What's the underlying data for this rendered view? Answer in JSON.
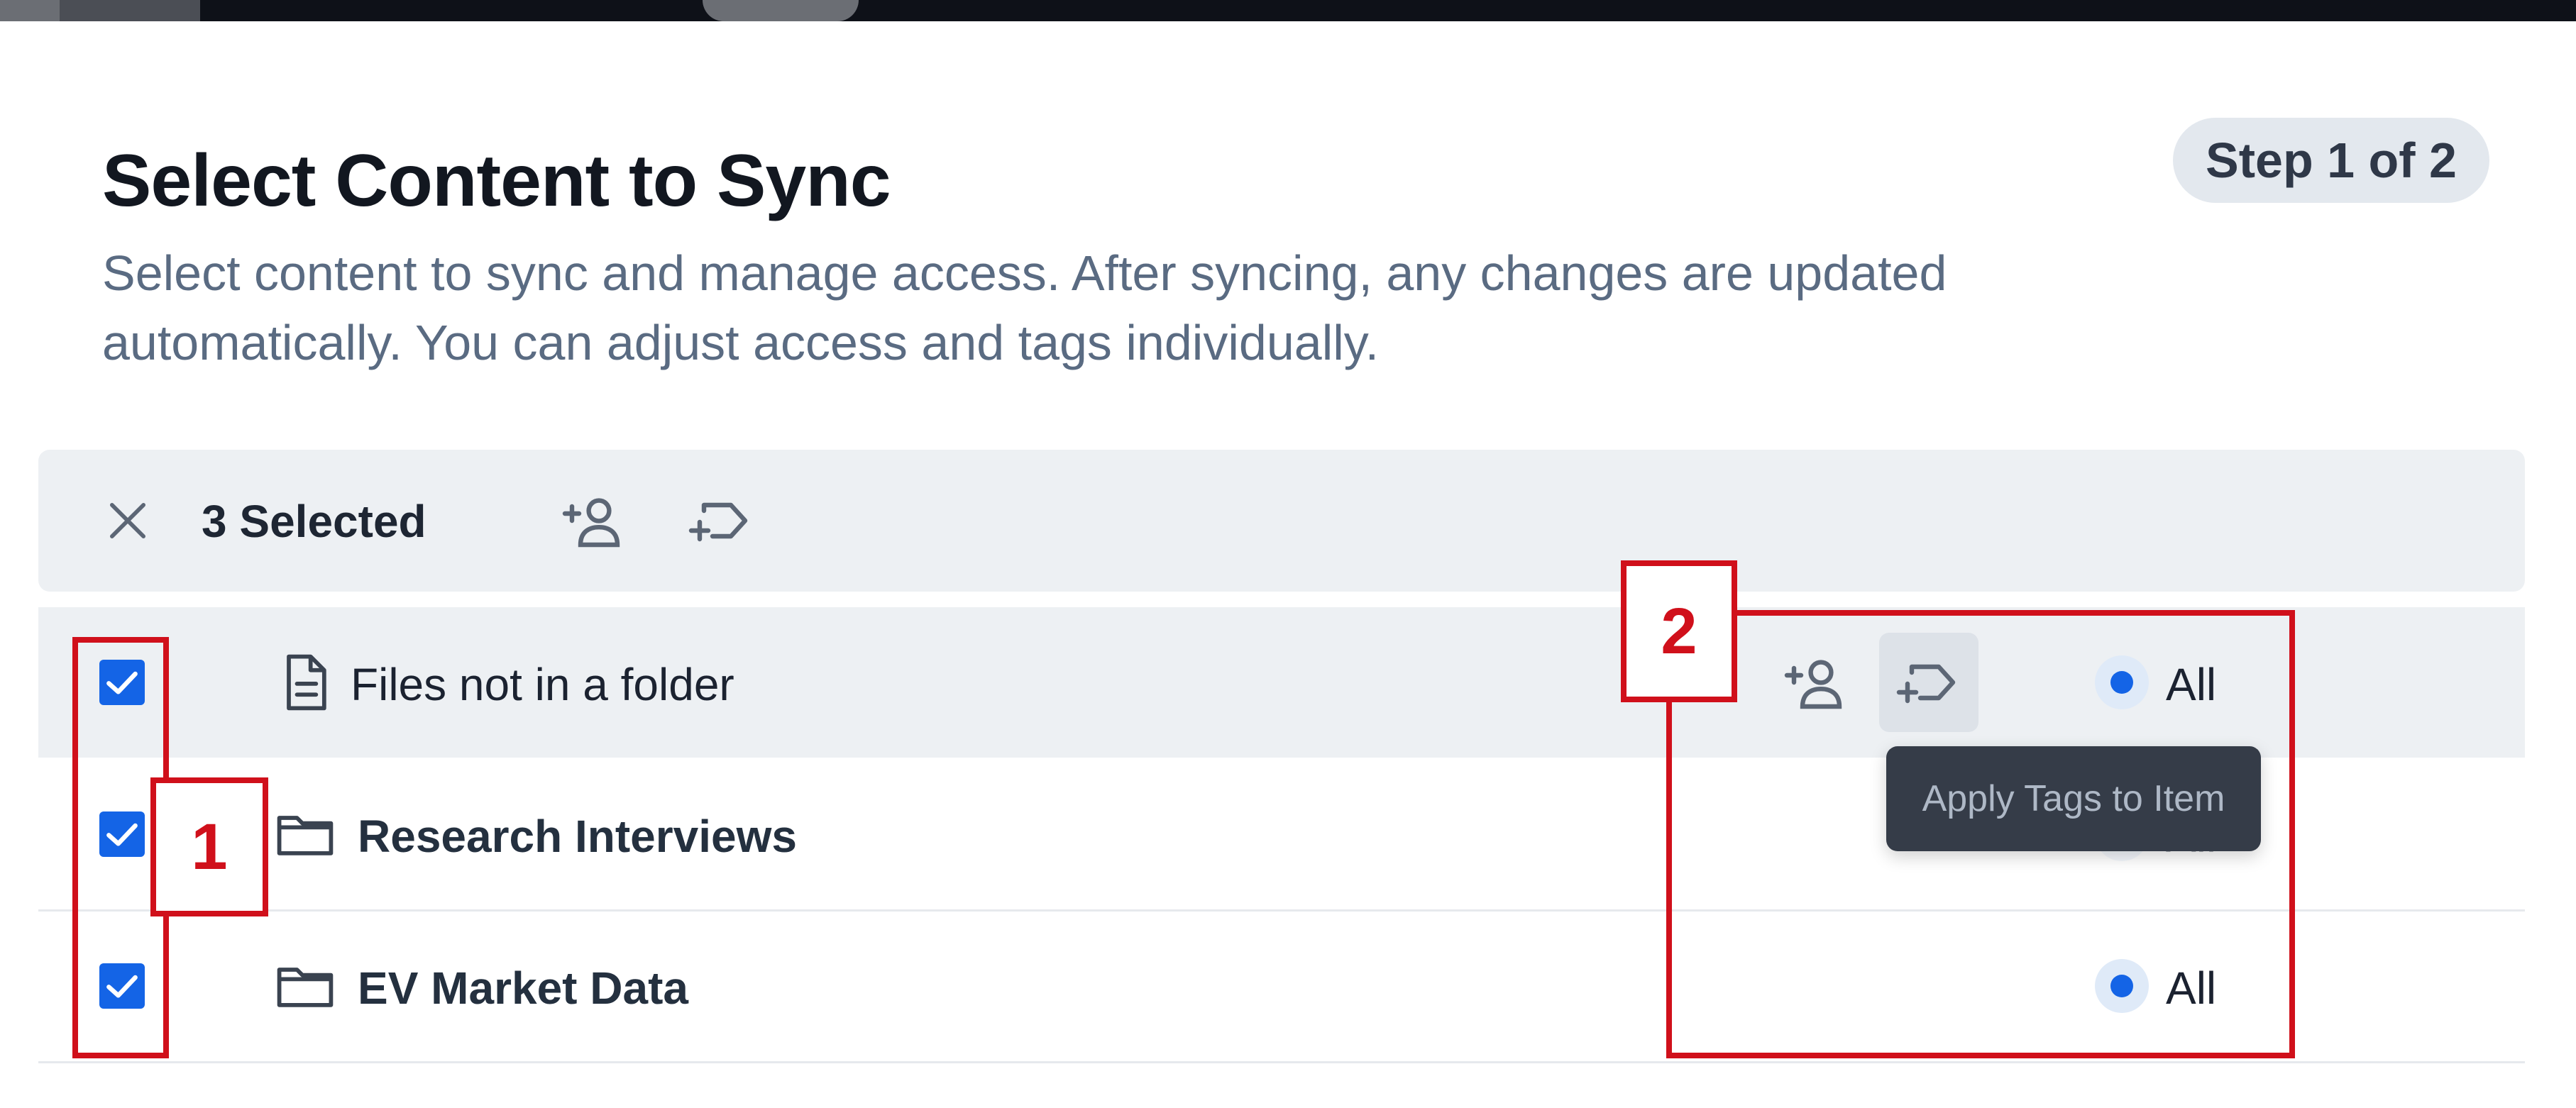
{
  "header": {
    "title": "Select Content to Sync",
    "subtitle": "Select content to sync and manage access. After syncing, any changes are updated automatically. You can adjust access and tags individually.",
    "step_badge": "Step 1 of 2"
  },
  "toolbar": {
    "close_icon": "close-icon",
    "selected_count": "3 Selected",
    "add_user_icon": "add-user-icon",
    "add_tag_icon": "add-tag-icon"
  },
  "rows": [
    {
      "label": "Files not in a folder",
      "icon": "file-icon",
      "checked": true,
      "access": "All"
    },
    {
      "label": "Research Interviews",
      "icon": "folder-icon",
      "checked": true,
      "access": "All"
    },
    {
      "label": "EV Market Data",
      "icon": "folder-icon",
      "checked": true,
      "access": "All"
    }
  ],
  "tooltip": {
    "text": "Apply Tags to Item"
  },
  "annotations": [
    {
      "label": "1"
    },
    {
      "label": "2"
    }
  ],
  "colors": {
    "accent": "#1464e6",
    "annotation": "#d0101b",
    "toolbar_bg": "#edf0f3",
    "tooltip_bg": "#353c48"
  }
}
